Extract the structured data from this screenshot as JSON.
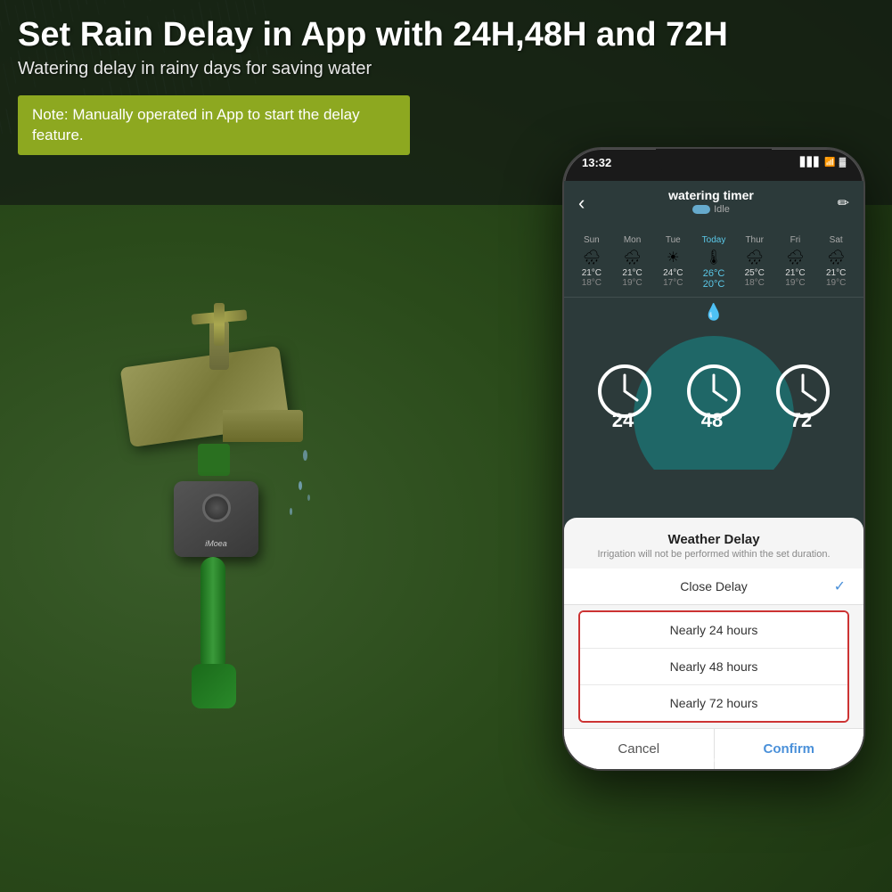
{
  "header": {
    "main_title": "Set Rain Delay in App with 24H,48H and 72H",
    "subtitle": "Watering delay in rainy days for saving water",
    "note_text": "Note: Manually operated in App to start the delay feature."
  },
  "phone": {
    "status_bar": {
      "time": "13:32",
      "icons": "📶 🔋"
    },
    "app": {
      "title": "watering timer",
      "status": "Idle",
      "back_label": "‹",
      "edit_icon": "✏",
      "weather_days": [
        {
          "name": "Sun",
          "icon": "🌧",
          "high": "21°C",
          "low": "18°C",
          "today": false
        },
        {
          "name": "Mon",
          "icon": "🌧",
          "high": "21°C",
          "low": "19°C",
          "today": false
        },
        {
          "name": "Tue",
          "icon": "☀",
          "high": "24°C",
          "low": "17°C",
          "today": false
        },
        {
          "name": "Today",
          "icon": "🌡",
          "high": "26°C",
          "low": "20°C",
          "today": true
        },
        {
          "name": "Thur",
          "icon": "🌧",
          "high": "25°C",
          "low": "18°C",
          "today": false
        },
        {
          "name": "Fri",
          "icon": "🌧",
          "high": "21°C",
          "low": "19°C",
          "today": false
        },
        {
          "name": "Sat",
          "icon": "🌧",
          "high": "21°C",
          "low": "19°C",
          "today": false
        }
      ],
      "delay_options": [
        "24",
        "48",
        "72"
      ],
      "modal": {
        "title": "Weather Delay",
        "subtitle": "Irrigation will not be performed within the set duration.",
        "option_close": "Close Delay",
        "option_24h": "Nearly 24 hours",
        "option_48h": "Nearly 48 hours",
        "option_72h": "Nearly 72 hours",
        "btn_cancel": "Cancel",
        "btn_confirm": "Confirm"
      }
    }
  },
  "overlay_text": {
    "line1": "Weather Delay Irrigation performed",
    "line2": ""
  },
  "colors": {
    "accent_green": "#8da820",
    "accent_blue": "#4a90d9",
    "teal": "#1a7a7a",
    "red_border": "#cc3333"
  }
}
